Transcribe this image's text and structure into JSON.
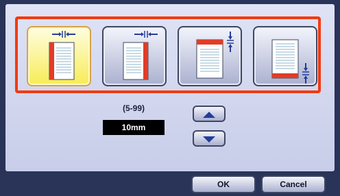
{
  "binding_options": [
    {
      "icon": "left-binding-icon",
      "selected": true
    },
    {
      "icon": "right-binding-icon",
      "selected": false
    },
    {
      "icon": "top-binding-icon",
      "selected": false
    },
    {
      "icon": "bottom-binding-icon",
      "selected": false
    }
  ],
  "margin": {
    "range_label": "(5-99)",
    "value": "10mm"
  },
  "stepper": {
    "up_icon": "arrow-up-icon",
    "down_icon": "arrow-down-icon"
  },
  "actions": {
    "ok_label": "OK",
    "cancel_label": "Cancel"
  },
  "colors": {
    "highlight": "#f23a10",
    "selected_bg": "#f7ec56",
    "frame": "#2a3358",
    "binding_edge": "#e23c28",
    "arrow": "#243d9a"
  }
}
